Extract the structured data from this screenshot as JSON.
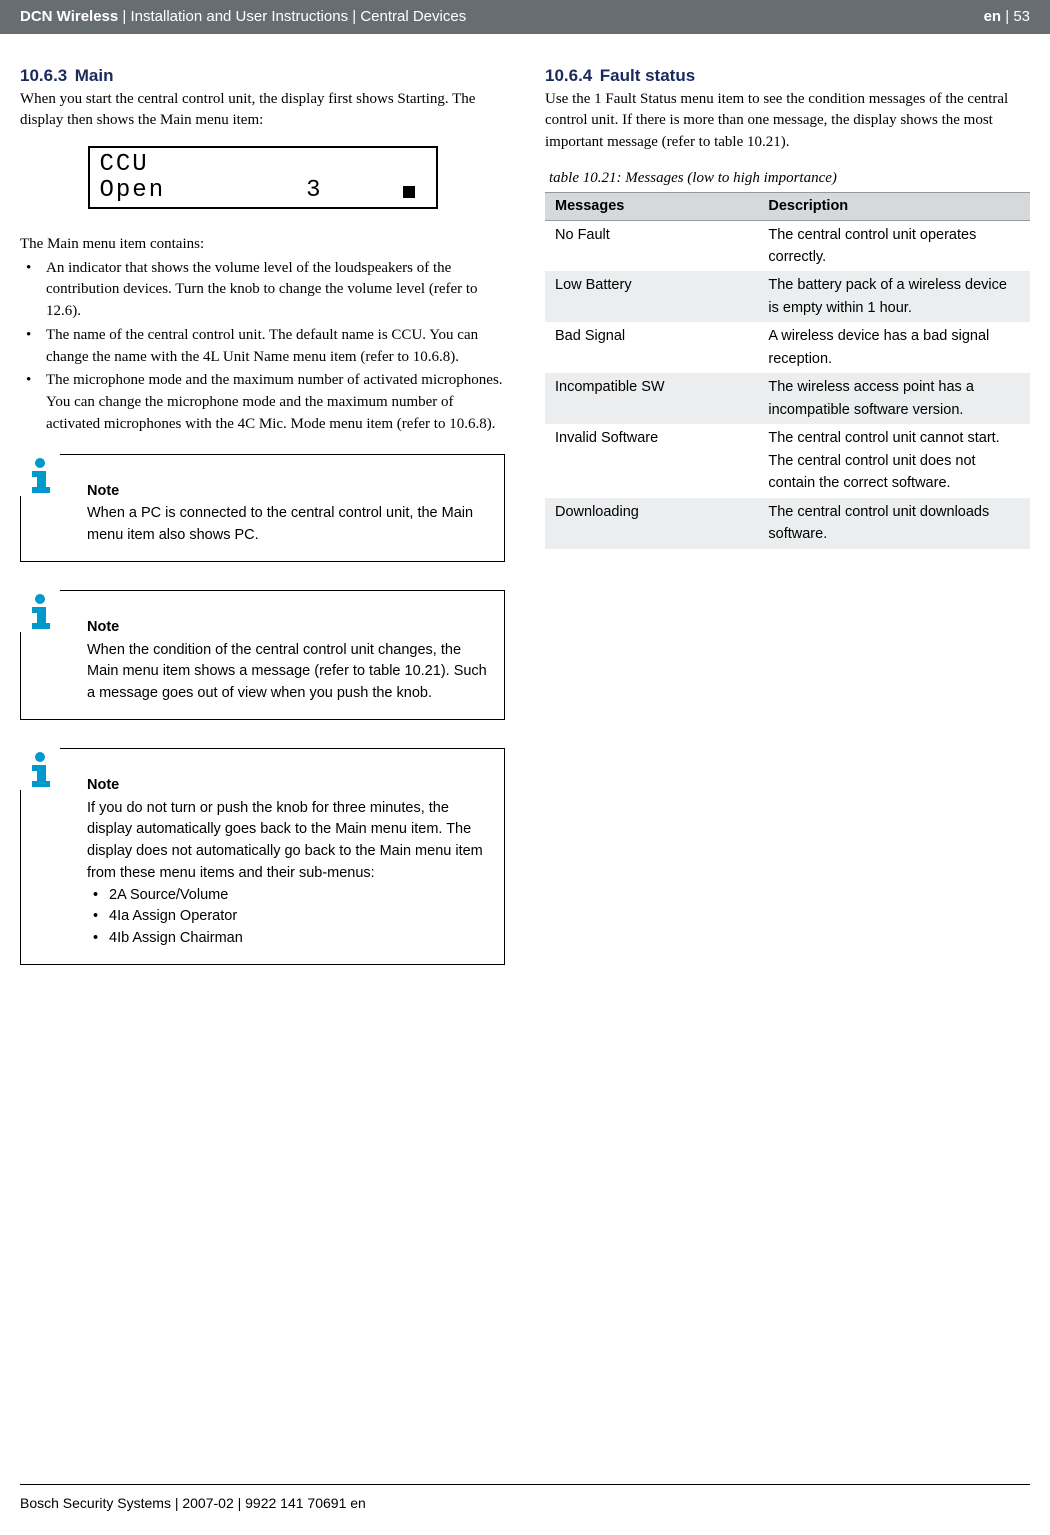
{
  "header": {
    "product": "DCN Wireless",
    "sep1": " | ",
    "doc_title": "Installation and User Instructions",
    "sep2": " | ",
    "chapter": "Central Devices",
    "lang": "en",
    "page_sep": " | ",
    "page": "53"
  },
  "left": {
    "sec_num": "10.6.3",
    "sec_title": "Main",
    "intro": "When you start the central control unit, the display first shows Starting. The display then shows the Main menu item:",
    "lcd_line1": "CCU",
    "lcd_line2_left": "Open",
    "lcd_line2_num": "3",
    "list_intro": "The Main menu item contains:",
    "bullets": [
      "An indicator that shows the volume level of the loudspeakers of the contribution devices. Turn the knob to change the volume level (refer to 12.6).",
      "The name of the central control unit. The default name is CCU. You can change the name with the 4L Unit Name menu item (refer to 10.6.8).",
      "The microphone mode and the maximum number of activated microphones. You can change the microphone mode and the maximum number of activated microphones with the 4C Mic. Mode menu item (refer to 10.6.8)."
    ],
    "note1_label": "Note",
    "note1_text": "When a PC is connected to the central control unit, the Main menu item also shows PC.",
    "note2_label": "Note",
    "note2_text": "When the condition of the central control unit changes, the Main menu item shows a message (refer to table 10.21). Such a message goes out of view when you push the knob.",
    "note3_label": "Note",
    "note3_text": "If you do not turn or push the knob for three minutes, the display automatically goes back to the Main menu item. The display does not automatically go back to the Main menu item from these menu items and their sub-menus:",
    "note3_items": [
      "2A Source/Volume",
      "4Ia Assign Operator",
      "4Ib Assign Chairman"
    ]
  },
  "right": {
    "sec_num": "10.6.4",
    "sec_title": "Fault status",
    "intro": "Use the 1 Fault Status menu item to see the condition messages of the central control unit. If there is more than one message, the display shows the most important message (refer to table 10.21).",
    "table_caption": "table 10.21: Messages (low to high importance)",
    "th1": "Messages",
    "th2": "Description",
    "rows": [
      {
        "msg": "No Fault",
        "desc": "The central control unit operates correctly."
      },
      {
        "msg": "Low Battery",
        "desc": "The battery pack of a wireless device is empty within 1 hour."
      },
      {
        "msg": "Bad Signal",
        "desc": "A wireless device has a bad signal reception."
      },
      {
        "msg": "Incompatible SW",
        "desc": "The wireless access point has a incompatible software version."
      },
      {
        "msg": "Invalid Software",
        "desc": "The central control unit cannot start. The central control unit does not contain the correct software."
      },
      {
        "msg": "Downloading",
        "desc": "The central control unit downloads software."
      }
    ]
  },
  "footer": "Bosch Security Systems | 2007-02 | 9922 141 70691 en"
}
